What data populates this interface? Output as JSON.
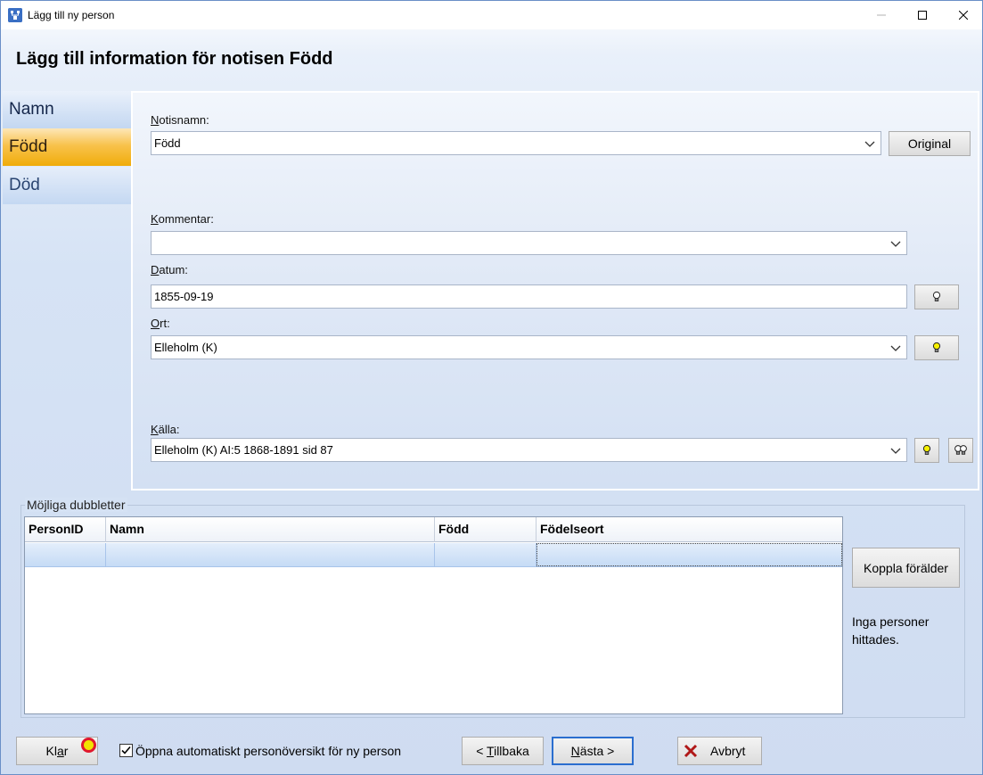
{
  "window": {
    "title": "Lägg till ny person",
    "icon": "person-tree-icon"
  },
  "heading": "Lägg till information för notisen Född",
  "nav": {
    "items": [
      {
        "label": "Namn"
      },
      {
        "label": "Född",
        "selected": true
      },
      {
        "label": "Död"
      }
    ]
  },
  "form": {
    "notisnamn": {
      "label_hot": "N",
      "label_rest": "otisnamn:",
      "value": "Född",
      "original_button": "Original"
    },
    "kommentar": {
      "label_hot": "K",
      "label_rest": "ommentar:",
      "value": ""
    },
    "datum": {
      "label_hot": "D",
      "label_rest": "atum:",
      "value": "1855-09-19"
    },
    "ort": {
      "label_hot": "O",
      "label_rest": "rt:",
      "value": "Elleholm (K)"
    },
    "kalla": {
      "label_hot": "K",
      "label_rest": "älla:",
      "value": "Elleholm (K) AI:5 1868-1891 sid 87"
    }
  },
  "duplicates": {
    "group_title": "Möjliga dubbletter",
    "columns": [
      "PersonID",
      "Namn",
      "Född",
      "Födelseort"
    ],
    "rows": [
      [
        "",
        "",
        "",
        ""
      ]
    ],
    "link_parent_button": "Koppla förälder",
    "status_line1": "Inga personer",
    "status_line2": "hittades."
  },
  "footer": {
    "done_button_pre": "Kl",
    "done_button_hot": "a",
    "done_button_post": "r",
    "auto_overview_label": "Öppna automatiskt personöversikt för ny person",
    "auto_overview_checked": true,
    "back_button_pre": "< ",
    "back_button_hot": "T",
    "back_button_post": "illbaka",
    "next_button_pre": "",
    "next_button_hot": "N",
    "next_button_post": "ästa >",
    "cancel_button": "Avbryt"
  },
  "colors": {
    "selected_nav": "#f0ac0a",
    "nav": "#c3d7f1",
    "marker_fill": "#f2e200",
    "marker_ring": "#e0182d",
    "cancel_x": "#b01818"
  }
}
